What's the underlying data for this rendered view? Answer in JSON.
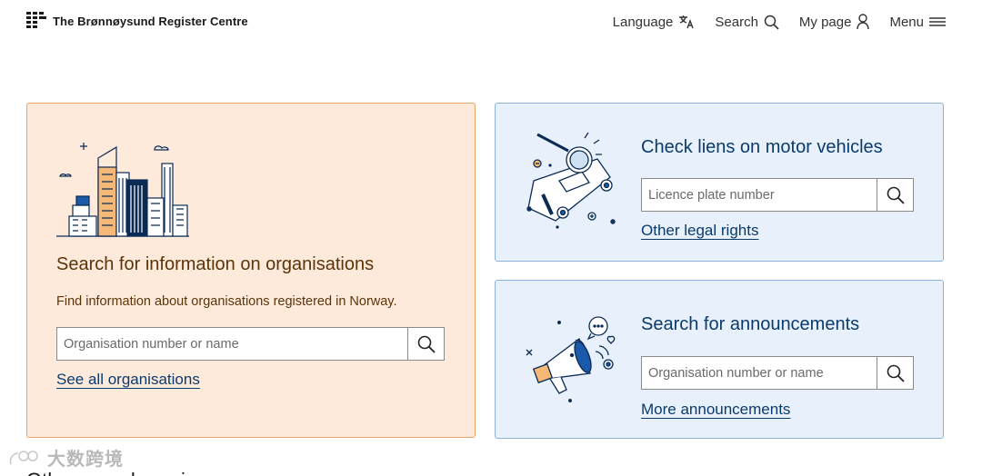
{
  "header": {
    "logo_text": "The Brønnøysund Register Centre",
    "nav": {
      "language": "Language",
      "search": "Search",
      "my_page": "My page",
      "menu": "Menu"
    }
  },
  "org_card": {
    "title": "Search for information on organisations",
    "description": "Find information about organisations registered in Norway.",
    "search_placeholder": "Organisation number or name",
    "link": "See all organisations"
  },
  "liens_card": {
    "title": "Check liens on motor vehicles",
    "search_placeholder": "Licence plate number",
    "link": "Other legal rights"
  },
  "announcements_card": {
    "title": "Search for announcements",
    "search_placeholder": "Organisation number or name",
    "link": "More announcements"
  },
  "below_heading": "Other search engines",
  "watermark": "大数跨境",
  "colors": {
    "org_card_bg": "#fdeadb",
    "org_card_border": "#e9a46a",
    "blue_card_bg": "#e8f1fb",
    "blue_card_border": "#8cb3dc",
    "link_color": "#0b3a6e",
    "org_text_color": "#5c3409"
  }
}
